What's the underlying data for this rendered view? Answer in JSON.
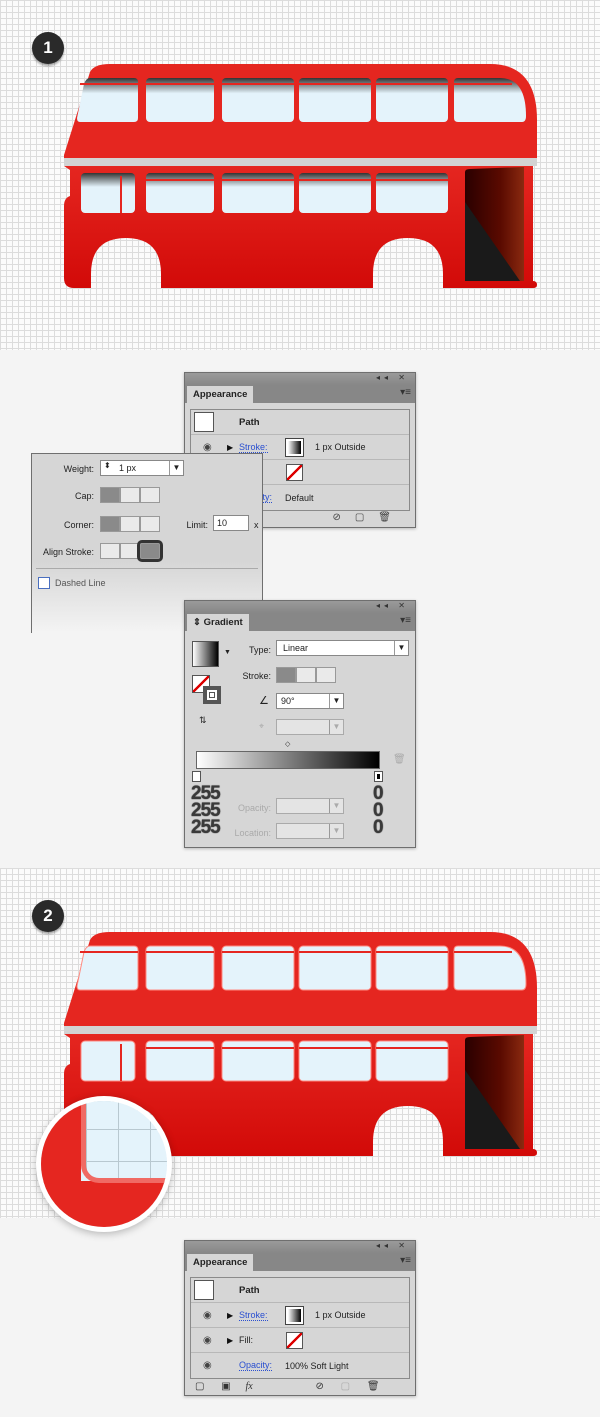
{
  "steps": [
    "1",
    "2"
  ],
  "colors": {
    "bus_red": "#e52620",
    "bus_red_dark": "#d20c0a",
    "window_fill": "#e4f3fb",
    "stripe_gray": "#d3d3d3",
    "panel_bg": "#d6d6d6",
    "link_blue": "#2a4fd0"
  },
  "appearance1": {
    "tab": "Appearance",
    "title_controls": "◂◂ ✕",
    "item": "Path",
    "stroke_label": "Stroke:",
    "stroke_value": "1 px  Outside",
    "opacity_label": "Opacity:",
    "opacity_value": "Default"
  },
  "stroke_panel": {
    "weight_label": "Weight:",
    "weight_value": "1 px",
    "cap_label": "Cap:",
    "corner_label": "Corner:",
    "limit_label": "Limit:",
    "limit_value": "10",
    "limit_unit": "x",
    "align_label": "Align Stroke:",
    "dashed_label": "Dashed Line"
  },
  "gradient": {
    "tab": "Gradient",
    "type_label": "Type:",
    "type_value": "Linear",
    "stroke_label": "Stroke:",
    "angle_value": "90°",
    "opacity_label": "Opacity:",
    "location_label": "Location:",
    "left_rgb": [
      "255",
      "255",
      "255"
    ],
    "right_rgb": [
      "0",
      "0",
      "0"
    ]
  },
  "appearance2": {
    "tab": "Appearance",
    "item": "Path",
    "stroke_label": "Stroke:",
    "stroke_value": "1 px  Outside",
    "fill_label": "Fill:",
    "opacity_label": "Opacity:",
    "opacity_value": "100% Soft Light",
    "fx_label": "fx"
  }
}
